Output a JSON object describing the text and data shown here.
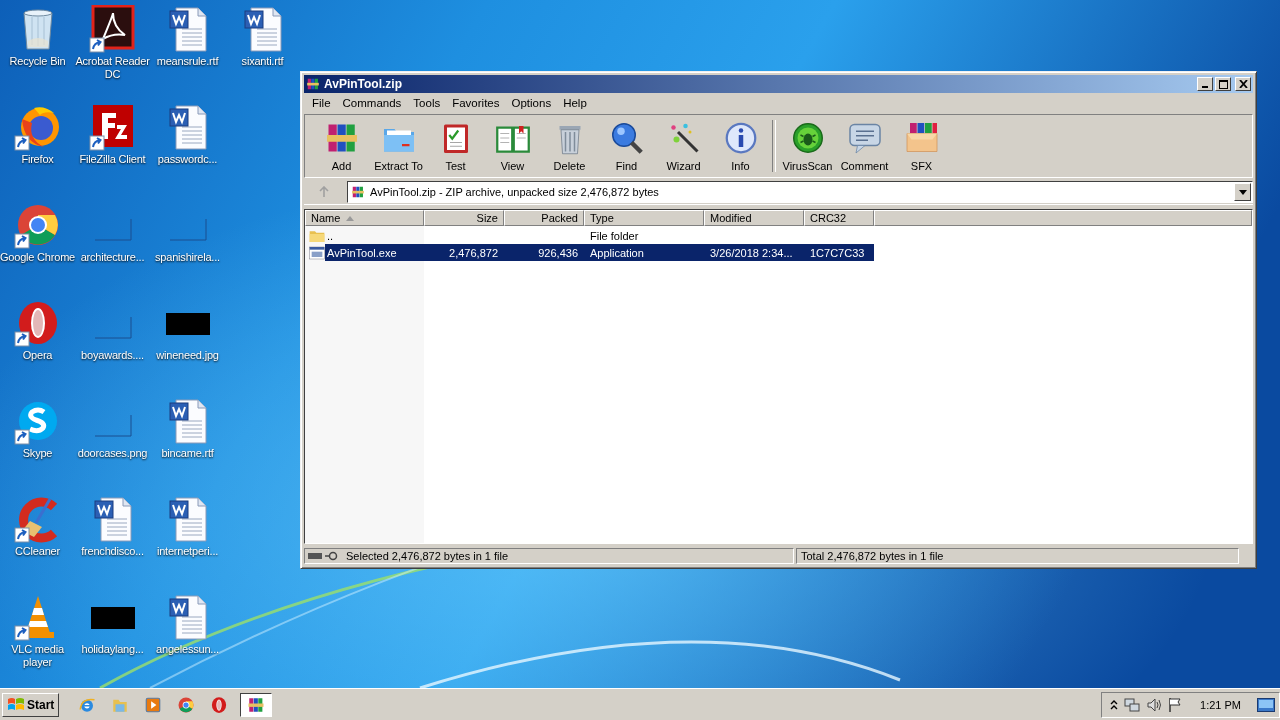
{
  "desktop": {
    "icons": [
      {
        "label": "Recycle Bin",
        "kind": "recycle",
        "shortcut": false
      },
      {
        "label": "Firefox",
        "kind": "firefox",
        "shortcut": true
      },
      {
        "label": "Google Chrome",
        "kind": "chrome",
        "shortcut": true
      },
      {
        "label": "Opera",
        "kind": "opera",
        "shortcut": true
      },
      {
        "label": "Skype",
        "kind": "skype",
        "shortcut": true
      },
      {
        "label": "CCleaner",
        "kind": "ccleaner",
        "shortcut": true
      },
      {
        "label": "VLC media player",
        "kind": "vlc",
        "shortcut": true
      },
      {
        "label": "Acrobat Reader DC",
        "kind": "acrobat",
        "shortcut": true
      },
      {
        "label": "FileZilla Client",
        "kind": "filezilla",
        "shortcut": true
      },
      {
        "label": "architecture...",
        "kind": "blank",
        "shortcut": false
      },
      {
        "label": "boyawards....",
        "kind": "blank",
        "shortcut": false
      },
      {
        "label": "doorcases.png",
        "kind": "blank",
        "shortcut": false
      },
      {
        "label": "frenchdisco...",
        "kind": "word",
        "shortcut": false
      },
      {
        "label": "holidaylang...",
        "kind": "black",
        "shortcut": false
      },
      {
        "label": "meansrule.rtf",
        "kind": "word",
        "shortcut": false
      },
      {
        "label": "passwordc...",
        "kind": "word",
        "shortcut": false
      },
      {
        "label": "spanishirela...",
        "kind": "blank",
        "shortcut": false
      },
      {
        "label": "wineneed.jpg",
        "kind": "black",
        "shortcut": false
      },
      {
        "label": "bincame.rtf",
        "kind": "word",
        "shortcut": false
      },
      {
        "label": "internetperi...",
        "kind": "word",
        "shortcut": false
      },
      {
        "label": "angelessun...",
        "kind": "word",
        "shortcut": false
      },
      {
        "label": "sixanti.rtf",
        "kind": "word",
        "shortcut": false
      }
    ]
  },
  "window": {
    "title": "AvPinTool.zip",
    "menu": [
      "File",
      "Commands",
      "Tools",
      "Favorites",
      "Options",
      "Help"
    ],
    "toolbar": {
      "groups": [
        [
          {
            "label": "Add",
            "kind": "add"
          },
          {
            "label": "Extract To",
            "kind": "extract"
          },
          {
            "label": "Test",
            "kind": "test"
          },
          {
            "label": "View",
            "kind": "view"
          },
          {
            "label": "Delete",
            "kind": "delete"
          },
          {
            "label": "Find",
            "kind": "find"
          },
          {
            "label": "Wizard",
            "kind": "wizard"
          },
          {
            "label": "Info",
            "kind": "info"
          }
        ],
        [
          {
            "label": "VirusScan",
            "kind": "virusscan"
          },
          {
            "label": "Comment",
            "kind": "comment"
          },
          {
            "label": "SFX",
            "kind": "sfx"
          }
        ]
      ]
    },
    "address": {
      "text": "AvPinTool.zip - ZIP archive, unpacked size 2,476,872 bytes",
      "up_disabled": true
    },
    "table": {
      "columns": [
        {
          "label": "Name",
          "sorted": true
        },
        {
          "label": "Size",
          "sorted": false
        },
        {
          "label": "Packed",
          "sorted": false
        },
        {
          "label": "Type",
          "sorted": false
        },
        {
          "label": "Modified",
          "sorted": false
        },
        {
          "label": "CRC32",
          "sorted": false
        }
      ],
      "rows": [
        {
          "kind": "folder",
          "name": "..",
          "type": "File folder",
          "selected": false
        },
        {
          "kind": "exe",
          "name": "AvPinTool.exe",
          "size": "2,476,872",
          "packed": "926,436",
          "type": "Application",
          "modified": "3/26/2018 2:34...",
          "crc": "1C7C7C33",
          "selected": true
        }
      ]
    },
    "status_bar": {
      "left": "Selected 2,476,872 bytes in 1 file",
      "right": "Total 2,476,872 bytes in 1 file"
    }
  },
  "taskbar": {
    "start": "Start",
    "apps": [
      {
        "kind": "ie",
        "active": false
      },
      {
        "kind": "explorer",
        "active": false
      },
      {
        "kind": "media",
        "active": false
      },
      {
        "kind": "chrome",
        "active": false
      },
      {
        "kind": "opera",
        "active": false
      },
      {
        "kind": "winrar",
        "active": true
      }
    ],
    "clock": "1:21 PM"
  }
}
